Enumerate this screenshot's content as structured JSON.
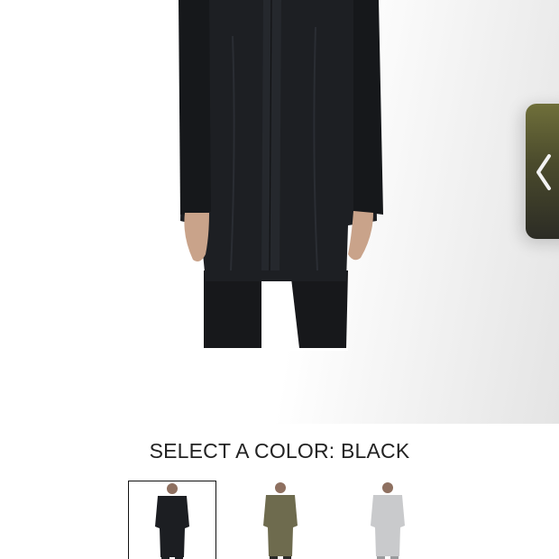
{
  "product": {
    "image_icon": "coat-on-model-image",
    "selected_color": "black"
  },
  "gallery_tab": {
    "icon": "chevron-left-icon",
    "color": "#4a4a2c"
  },
  "color_selector": {
    "heading": "SELECT A COLOR:",
    "selected_value": "BLACK",
    "swatches": [
      {
        "color_name": "Black",
        "hex": "#1c1e22",
        "selected": true
      },
      {
        "color_name": "Olive",
        "hex": "#6e6b4e",
        "selected": false
      },
      {
        "color_name": "Grey",
        "hex": "#c9cacc",
        "selected": false
      }
    ]
  }
}
